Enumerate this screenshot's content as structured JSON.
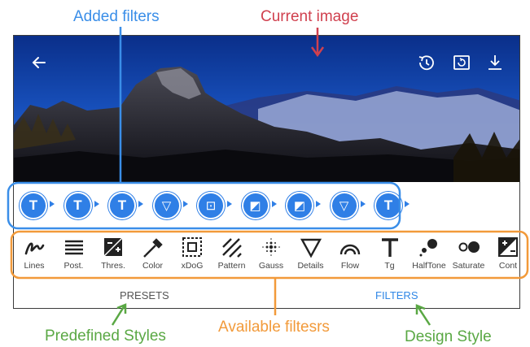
{
  "annotations": {
    "added_filters": "Added filters",
    "current_image": "Current image",
    "predefined_styles": "Predefined Styles",
    "available_filters": "Available filtesrs",
    "design_style": "Design Style"
  },
  "toolbar": {
    "back_icon": "arrow-left-icon",
    "history_icon": "history-icon",
    "compare_icon": "compare-icon",
    "download_icon": "download-icon"
  },
  "pipeline": {
    "nodes": [
      "T",
      "T",
      "T",
      "▽",
      "⊡",
      "◩",
      "◩",
      "▽",
      "T"
    ]
  },
  "filters": [
    {
      "label": "Lines",
      "icon": "lines-icon"
    },
    {
      "label": "Post.",
      "icon": "posterize-icon"
    },
    {
      "label": "Thres.",
      "icon": "threshold-icon"
    },
    {
      "label": "Color",
      "icon": "color-picker-icon"
    },
    {
      "label": "xDoG",
      "icon": "xdog-icon"
    },
    {
      "label": "Pattern",
      "icon": "pattern-icon"
    },
    {
      "label": "Gauss",
      "icon": "gauss-icon"
    },
    {
      "label": "Details",
      "icon": "details-icon"
    },
    {
      "label": "Flow",
      "icon": "flow-icon"
    },
    {
      "label": "Tg",
      "icon": "tg-icon"
    },
    {
      "label": "HalfTone",
      "icon": "halftone-icon"
    },
    {
      "label": "Saturate",
      "icon": "saturate-icon"
    },
    {
      "label": "Cont",
      "icon": "contrast-icon"
    }
  ],
  "tabs": {
    "presets": "PRESETS",
    "filters": "FILTERS"
  },
  "colors": {
    "accent": "#2f7fe6",
    "added_filters_annotation": "#3a8ee8",
    "current_image_annotation": "#d0404e",
    "available_annotation": "#f29a3a",
    "style_annotation": "#5aa844"
  }
}
